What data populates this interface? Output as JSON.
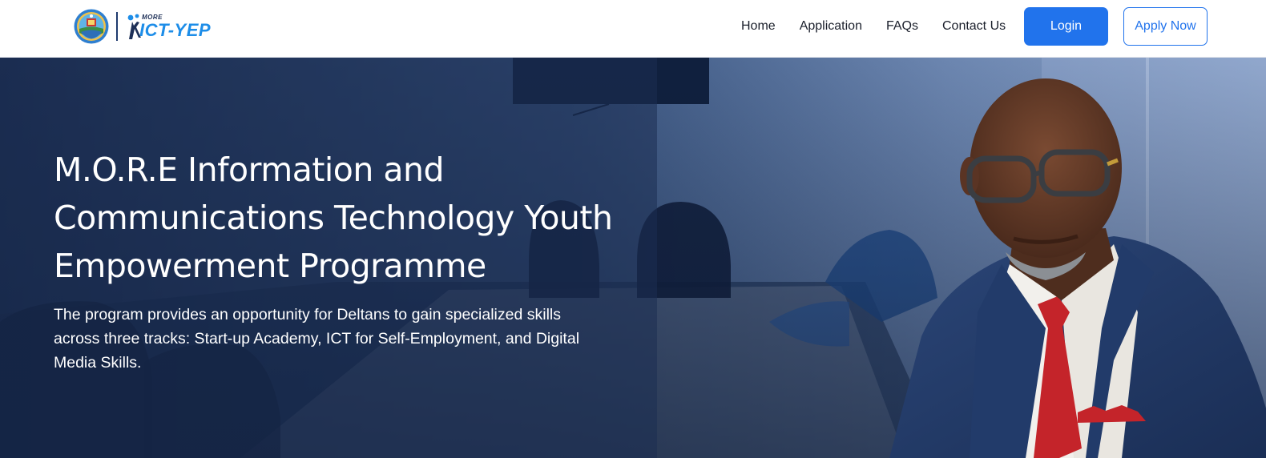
{
  "header": {
    "logo": {
      "seal_icon": "delta-state-seal-icon",
      "small_text": "MORE",
      "big_text": "ICT-YEP"
    },
    "nav": [
      {
        "label": "Home"
      },
      {
        "label": "Application"
      },
      {
        "label": "FAQs"
      },
      {
        "label": "Contact Us"
      }
    ],
    "login_label": "Login",
    "apply_label": "Apply Now"
  },
  "hero": {
    "title": "M.O.R.E Information and Communications Technology Youth Empowerment Programme",
    "description": "The program provides an opportunity for Deltans to gain specialized skills across three tracks: Start-up Academy, ICT for Self-Employment, and Digital Media Skills.",
    "overlay_color": "#1c2e52",
    "image": "meeting-room-background",
    "portrait": "governor-portrait"
  },
  "colors": {
    "primary": "#2173ec",
    "logo_blue": "#1d8de8",
    "logo_navy": "#1d2f57"
  }
}
